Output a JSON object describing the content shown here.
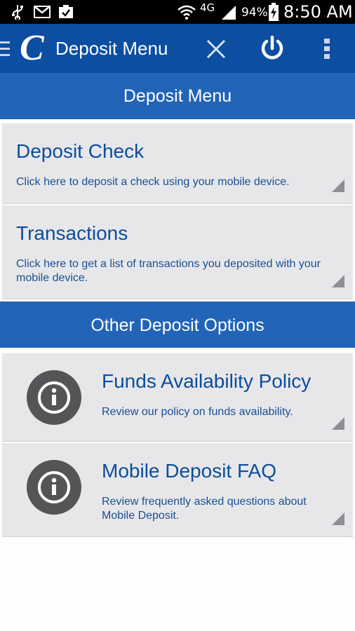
{
  "status_bar": {
    "time": "8:50 AM",
    "battery": "94%",
    "network": "4G",
    "icons": [
      "usb-icon",
      "gmail-icon",
      "task-icon",
      "wifi-icon",
      "signal-icon",
      "battery-charging-icon"
    ]
  },
  "app_bar": {
    "logo": "C",
    "title": "Deposit Menu",
    "icons": [
      "menu-icon",
      "close-icon",
      "power-icon",
      "overflow-menu-icon"
    ]
  },
  "sections": {
    "deposit_header": "Deposit Menu",
    "other_header": "Other Deposit Options"
  },
  "deposit_items": [
    {
      "title": "Deposit Check",
      "description": "Click here to deposit a check using your mobile device."
    },
    {
      "title": "Transactions",
      "description": "Click here to get a list of transactions you deposited with your mobile device."
    }
  ],
  "other_items": [
    {
      "title": "Funds Availability Policy",
      "description": "Review our policy on funds availability.",
      "icon": "info-icon"
    },
    {
      "title": "Mobile Deposit FAQ",
      "description": "Review frequently asked questions about Mobile Deposit.",
      "icon": "info-icon"
    }
  ],
  "colors": {
    "app_bar": "#0c4ea2",
    "section_header": "#2264b8",
    "card_bg": "#e7e7ea",
    "card_text": "#0b4d9d"
  }
}
